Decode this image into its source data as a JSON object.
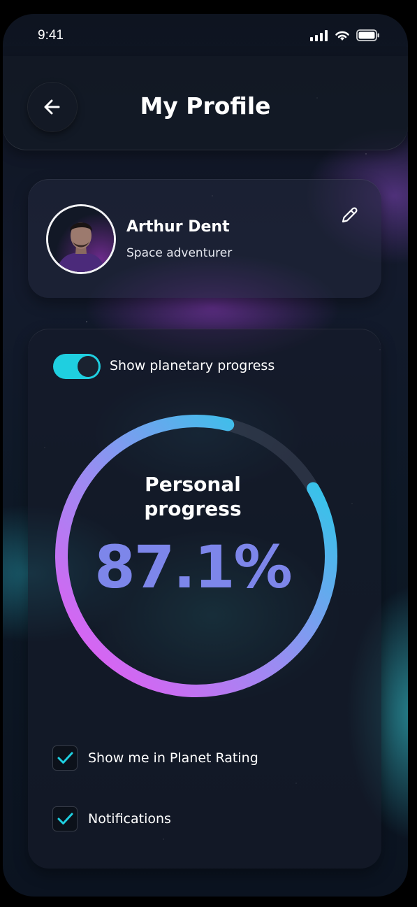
{
  "status_bar": {
    "time": "9:41",
    "icons": [
      "cellular-signal-icon",
      "wifi-icon",
      "battery-icon"
    ]
  },
  "header": {
    "title": "My Profile",
    "back_icon": "arrow-left-icon"
  },
  "profile": {
    "name": "Arthur Dent",
    "role": "Space adventurer",
    "edit_icon": "pencil-icon"
  },
  "progress_section": {
    "toggle_label": "Show planetary progress",
    "toggle_on": true,
    "title_line1": "Personal",
    "title_line2": "progress",
    "value_text": "87.1%",
    "value": 0.871
  },
  "options": [
    {
      "label": "Show me in Planet Rating",
      "checked": true
    },
    {
      "label": "Notifications",
      "checked": true
    }
  ],
  "colors": {
    "accent_cyan": "#1fcfe0",
    "accent_magenta": "#e25bf0",
    "accent_blue": "#7d86ea",
    "text": "#ffffff"
  }
}
